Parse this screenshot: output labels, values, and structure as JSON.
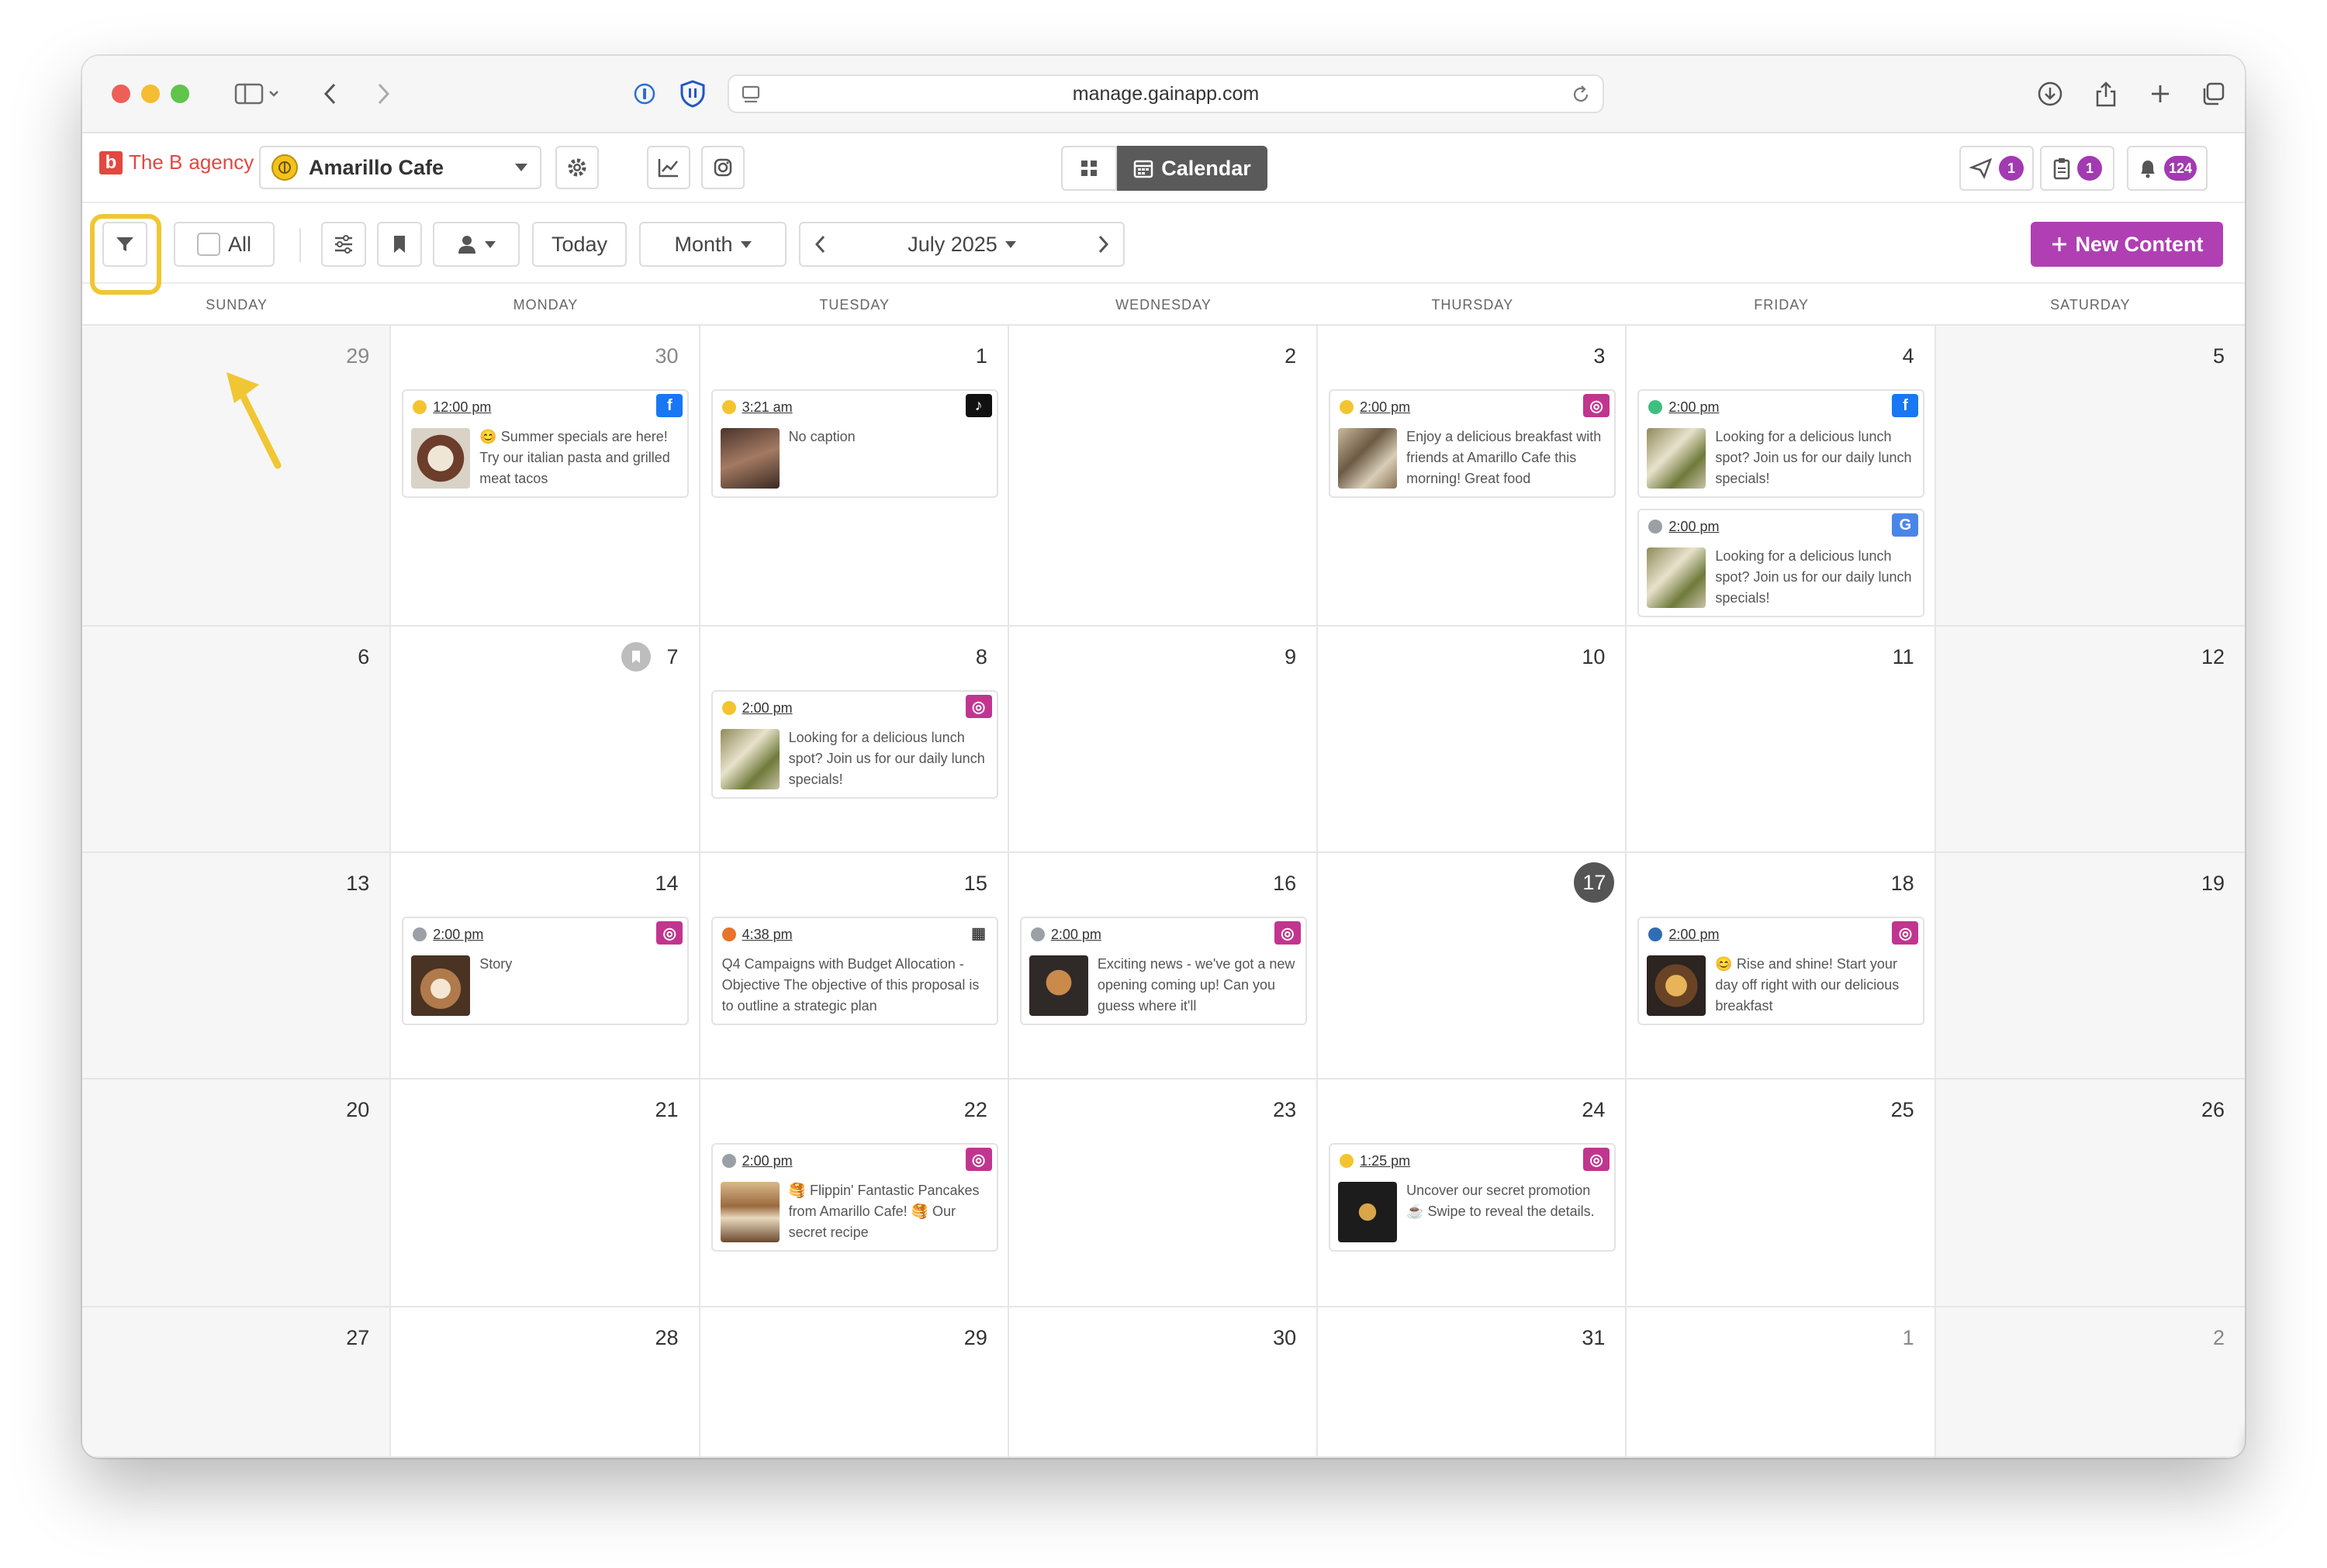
{
  "browser": {
    "url": "manage.gainapp.com"
  },
  "header": {
    "brand_b": "b",
    "brand_the": "The B",
    "brand_agency": "agency",
    "location": "Amarillo Cafe",
    "view_calendar": "Calendar",
    "send_count": "1",
    "clipboard_count": "1",
    "notifications_count": "124"
  },
  "toolbar": {
    "all_label": "All",
    "today_label": "Today",
    "view_label": "Month",
    "period_label": "July 2025",
    "new_content_label": "New Content"
  },
  "calendar": {
    "weekdays": [
      "SUNDAY",
      "MONDAY",
      "TUESDAY",
      "WEDNESDAY",
      "THURSDAY",
      "FRIDAY",
      "SATURDAY"
    ],
    "days": [
      "29",
      "30",
      "1",
      "2",
      "3",
      "4",
      "5",
      "6",
      "7",
      "8",
      "9",
      "10",
      "11",
      "12",
      "13",
      "14",
      "15",
      "16",
      "17",
      "18",
      "19",
      "20",
      "21",
      "22",
      "23",
      "24",
      "25",
      "26",
      "27",
      "28",
      "29",
      "30",
      "31",
      "1",
      "2"
    ],
    "posts": [
      {
        "time": "12:00 pm",
        "caption": "😊 Summer specials are here! Try our italian pasta and grilled meat tacos",
        "status_color": "#f4c430",
        "network": "f"
      },
      {
        "time": "3:21 am",
        "caption": "No caption",
        "status_color": "#f4c430",
        "network": "♪"
      },
      {
        "time": "2:00 pm",
        "caption": "Enjoy a delicious breakfast with friends at Amarillo Cafe this morning! Great food",
        "status_color": "#f4c430",
        "network": "◎"
      },
      {
        "time": "2:00 pm",
        "caption": "Looking for a delicious lunch spot? Join us for our daily lunch specials!",
        "status_color": "#3fbf7f",
        "network": "f"
      },
      {
        "time": "2:00 pm",
        "caption": "Looking for a delicious lunch spot? Join us for our daily lunch specials!",
        "status_color": "#9aa0a6",
        "network": "G"
      },
      {
        "time": "2:00 pm",
        "caption": "Looking for a delicious lunch spot? Join us for our daily lunch specials!",
        "status_color": "#f4c430",
        "network": "◎"
      },
      {
        "time": "2:00 pm",
        "caption": "Story",
        "status_color": "#9aa0a6",
        "network": "◎"
      },
      {
        "time": "4:38 pm",
        "caption": "Q4 Campaigns with Budget Allocation - Objective The objective of this proposal is to outline a strategic plan",
        "status_color": "#e8732b",
        "network": "▦"
      },
      {
        "time": "2:00 pm",
        "caption": "Exciting news - we've got a new opening coming up! Can you guess where it'll",
        "status_color": "#9aa0a6",
        "network": "◎"
      },
      {
        "time": "2:00 pm",
        "caption": "😊 Rise and shine! Start your day off right with our delicious breakfast",
        "status_color": "#2f6db5",
        "network": "◎"
      },
      {
        "time": "2:00 pm",
        "caption": "🥞 Flippin' Fantastic Pancakes from Amarillo Cafe! 🥞 Our secret recipe",
        "status_color": "#9aa0a6",
        "network": "◎"
      },
      {
        "time": "1:25 pm",
        "caption": "Uncover our secret promotion ☕ Swipe to reveal the details.",
        "status_color": "#f4c430",
        "network": "◎"
      }
    ]
  },
  "colors": {
    "accent": "#b03fb3",
    "highlight": "#f0c632",
    "instagram": "#c1358f",
    "facebook": "#1877f2"
  }
}
